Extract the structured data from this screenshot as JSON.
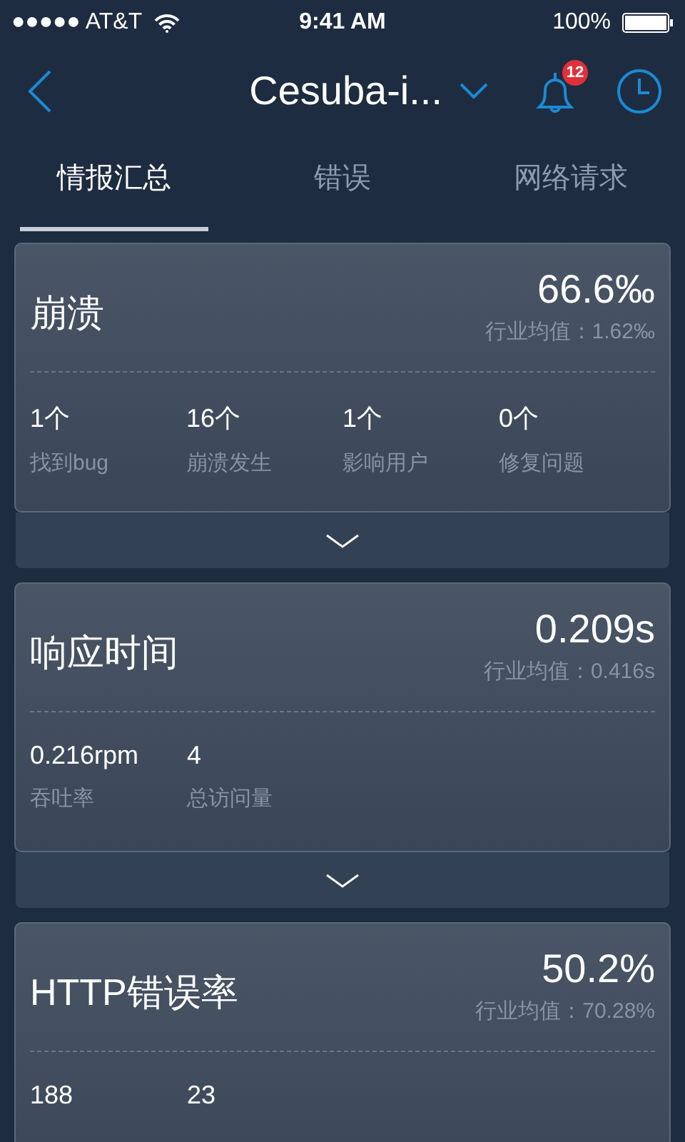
{
  "status_bar": {
    "carrier": "●●●●● AT&T",
    "time": "9:41 AM",
    "battery": "100%"
  },
  "nav": {
    "title": "Cesuba-i...",
    "badge": "12"
  },
  "tabs": [
    {
      "label": "情报汇总",
      "selected": true
    },
    {
      "label": "错误",
      "selected": false
    },
    {
      "label": "网络请求",
      "selected": false
    }
  ],
  "cards": [
    {
      "title": "崩溃",
      "value": "66.6‰",
      "average": "行业均值：1.62‰",
      "expanded": false,
      "stats": [
        {
          "value": "1个",
          "label": "找到bug"
        },
        {
          "value": "16个",
          "label": "崩溃发生"
        },
        {
          "value": "1个",
          "label": "影响用户"
        },
        {
          "value": "0个",
          "label": "修复问题"
        }
      ]
    },
    {
      "title": "响应时间",
      "value": "0.209s",
      "average": "行业均值：0.416s",
      "expanded": false,
      "stats": [
        {
          "value": "0.216rpm",
          "label": "吞吐率"
        },
        {
          "value": "4",
          "label": "总访问量"
        }
      ]
    },
    {
      "title": "HTTP错误率",
      "value": "50.2%",
      "average": "行业均值：70.28%",
      "stats": [
        {
          "value": "188"
        },
        {
          "value": "23"
        }
      ]
    }
  ]
}
